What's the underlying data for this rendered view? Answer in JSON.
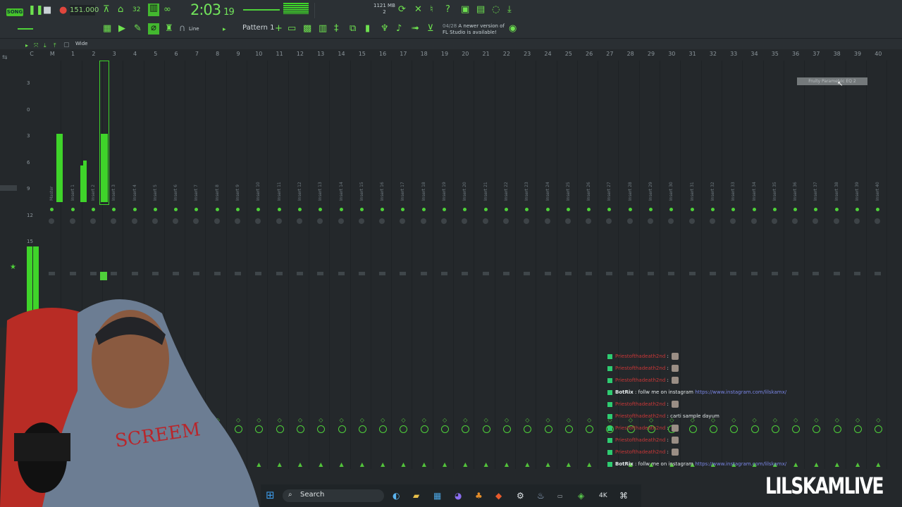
{
  "toolbar": {
    "mode_label": "SONG",
    "tempo": "151.000",
    "time_main": "2:03",
    "time_sub": "19",
    "memory": "1121 MB",
    "memory_sub": "2",
    "pattern": "Pattern 1",
    "snap_mode": "Line",
    "news_date": "04/28",
    "news_line1": "A newer version of",
    "news_line2": "FL Studio is available!"
  },
  "mixer": {
    "view_label": "Wide",
    "track_numbers": [
      "C",
      "M",
      "1",
      "2",
      "3",
      "4",
      "5",
      "6",
      "7",
      "8",
      "9",
      "10",
      "11",
      "12",
      "13",
      "14",
      "15",
      "16",
      "17",
      "18",
      "19",
      "20",
      "21",
      "22",
      "23",
      "24",
      "25",
      "26",
      "27",
      "28",
      "29",
      "30",
      "31",
      "32",
      "33",
      "34",
      "35",
      "36",
      "37",
      "38",
      "39",
      "40"
    ],
    "level_labels": [
      "3",
      "0",
      "3",
      "6",
      "9",
      "12",
      "15"
    ],
    "insert_labels": [
      "Master",
      "Insert 1",
      "Insert 2",
      "Insert 3",
      "Insert 4",
      "Insert 5",
      "Insert 6",
      "Insert 7",
      "Insert 8",
      "Insert 9",
      "Insert 10",
      "Insert 11",
      "Insert 12",
      "Insert 13",
      "Insert 14",
      "Insert 15",
      "Insert 16",
      "Insert 17",
      "Insert 18",
      "Insert 19",
      "Insert 20",
      "Insert 21",
      "Insert 22",
      "Insert 23",
      "Insert 24",
      "Insert 25",
      "Insert 26",
      "Insert 27",
      "Insert 28",
      "Insert 29",
      "Insert 30",
      "Insert 31",
      "Insert 32",
      "Insert 33",
      "Insert 34",
      "Insert 35",
      "Insert 36",
      "Insert 37",
      "Insert 38",
      "Insert 39",
      "Insert 40"
    ],
    "tooltip": "Fruity Parametric EQ 2"
  },
  "chat": [
    {
      "user": "Priestofthadeath2nd",
      "text": ":",
      "emote": true
    },
    {
      "user": "Priestofthadeath2nd",
      "text": ":",
      "emote": true
    },
    {
      "user": "Priestofthadeath2nd",
      "text": ":",
      "emote": true
    },
    {
      "user": "BotRix",
      "text": ": follw me on instagram",
      "link": "https://www.instagram.com/lilskamx/"
    },
    {
      "user": "Priestofthadeath2nd",
      "text": ":",
      "emote": true
    },
    {
      "user": "Priestofthadeath2nd",
      "text": ": carti sample dayum"
    },
    {
      "user": "Priestofthadeath2nd",
      "text": ":",
      "emote": true
    },
    {
      "user": "Priestofthadeath2nd",
      "text": ":",
      "emote": true
    },
    {
      "user": "Priestofthadeath2nd",
      "text": ":",
      "emote": true
    },
    {
      "user": "BotRix",
      "text": ": follw me on instagram",
      "link": "https://www.instagram.com/lilskamx/"
    }
  ],
  "taskbar": {
    "search_label": "Search"
  },
  "overlay": {
    "brand": "LILSKAMLIVE"
  },
  "colors": {
    "accent": "#6ee24f",
    "meter": "#3fd42a",
    "background": "#24282b"
  }
}
